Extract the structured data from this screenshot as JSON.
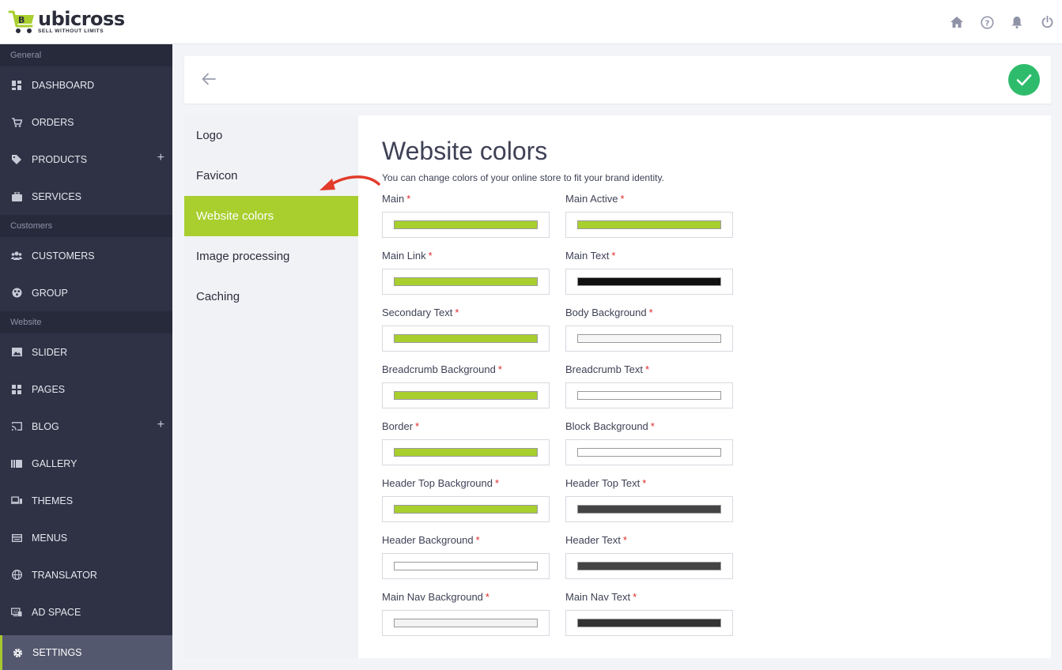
{
  "brand": {
    "name": "ubicross",
    "tagline": "SELL WITHOUT LIMITS",
    "accent": "#a8cf2e"
  },
  "topbar": {
    "icons": [
      "home-icon",
      "help-icon",
      "bell-icon",
      "power-icon"
    ]
  },
  "sidebar": {
    "sections": [
      {
        "label": "General",
        "items": [
          {
            "label": "DASHBOARD",
            "icon": "dashboard-icon"
          },
          {
            "label": "ORDERS",
            "icon": "cart-icon"
          },
          {
            "label": "PRODUCTS",
            "icon": "tag-icon",
            "plus": "+"
          },
          {
            "label": "SERVICES",
            "icon": "briefcase-icon"
          }
        ]
      },
      {
        "label": "Customers",
        "items": [
          {
            "label": "CUSTOMERS",
            "icon": "users-icon"
          },
          {
            "label": "GROUP",
            "icon": "group-icon"
          }
        ]
      },
      {
        "label": "Website",
        "items": [
          {
            "label": "SLIDER",
            "icon": "image-icon"
          },
          {
            "label": "PAGES",
            "icon": "pages-icon"
          },
          {
            "label": "BLOG",
            "icon": "cast-icon",
            "plus": "+"
          },
          {
            "label": "GALLERY",
            "icon": "gallery-icon"
          },
          {
            "label": "THEMES",
            "icon": "devices-icon"
          },
          {
            "label": "MENUS",
            "icon": "menu-icon"
          },
          {
            "label": "TRANSLATOR",
            "icon": "globe-icon"
          },
          {
            "label": "AD SPACE",
            "icon": "ad-icon"
          }
        ]
      }
    ],
    "settings": {
      "label": "SETTINGS",
      "icon": "gear-icon"
    }
  },
  "tabs": [
    "Logo",
    "Favicon",
    "Website colors",
    "Image processing",
    "Caching"
  ],
  "active_tab": "Website colors",
  "content": {
    "title": "Website colors",
    "subtitle": "You can change colors of your online store to fit your brand identity.",
    "required_mark": "*",
    "fields": [
      {
        "label": "Main",
        "color": "#a8cf2e"
      },
      {
        "label": "Main Active",
        "color": "#a8cf2e"
      },
      {
        "label": "Main Link",
        "color": "#a8cf2e"
      },
      {
        "label": "Main Text",
        "color": "#111111"
      },
      {
        "label": "Secondary Text",
        "color": "#a8cf2e"
      },
      {
        "label": "Body Background",
        "color": "#f6f6f6"
      },
      {
        "label": "Breadcrumb Background",
        "color": "#a8cf2e"
      },
      {
        "label": "Breadcrumb Text",
        "color": "#ffffff"
      },
      {
        "label": "Border",
        "color": "#a8cf2e"
      },
      {
        "label": "Block Background",
        "color": "#ffffff"
      },
      {
        "label": "Header Top Background",
        "color": "#a8cf2e"
      },
      {
        "label": "Header Top Text",
        "color": "#444444"
      },
      {
        "label": "Header Background",
        "color": "#ffffff"
      },
      {
        "label": "Header Text",
        "color": "#444444"
      },
      {
        "label": "Main Nav Background",
        "color": "#f3f3f3"
      },
      {
        "label": "Main Nav Text",
        "color": "#333333"
      }
    ]
  }
}
